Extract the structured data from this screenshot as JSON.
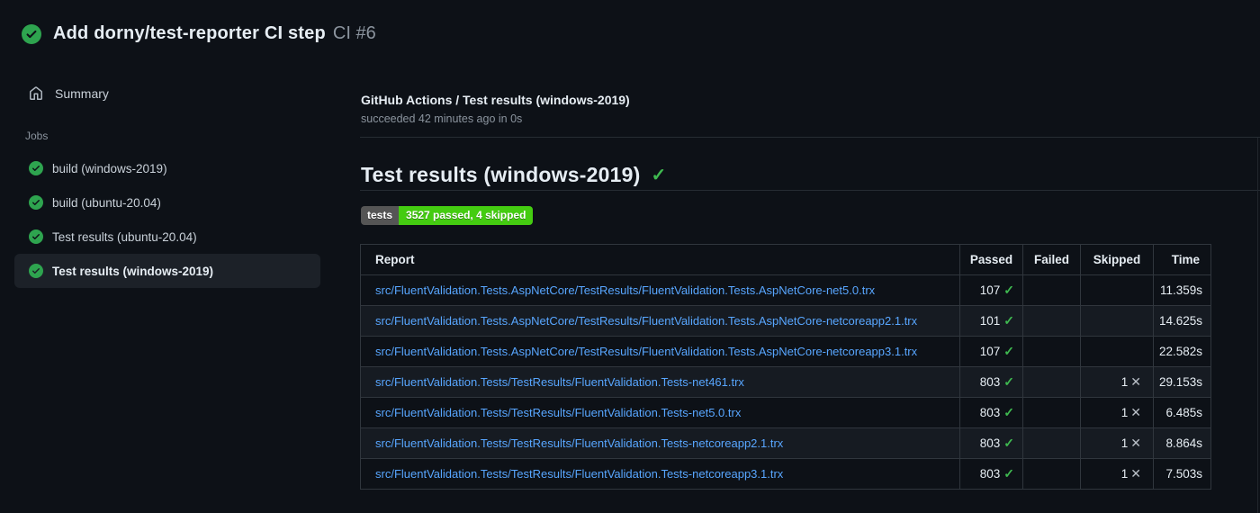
{
  "header": {
    "title": "Add dorny/test-reporter CI step",
    "run_number": "CI #6",
    "status_icon": "check-circle-icon"
  },
  "sidebar": {
    "summary_label": "Summary",
    "jobs_label": "Jobs",
    "jobs": [
      {
        "label": "build (windows-2019)",
        "selected": false
      },
      {
        "label": "build (ubuntu-20.04)",
        "selected": false
      },
      {
        "label": "Test results (ubuntu-20.04)",
        "selected": false
      },
      {
        "label": "Test results (windows-2019)",
        "selected": true
      }
    ]
  },
  "main": {
    "check_title": "GitHub Actions / Test results (windows-2019)",
    "check_status": "succeeded 42 minutes ago in 0s",
    "section_title": "Test results (windows-2019)",
    "badge": {
      "label": "tests",
      "value": "3527 passed, 4 skipped",
      "label_bg": "#555555",
      "value_bg": "#44cc11"
    },
    "table": {
      "columns": [
        "Report",
        "Passed",
        "Failed",
        "Skipped",
        "Time"
      ],
      "rows": [
        {
          "report": "src/FluentValidation.Tests.AspNetCore/TestResults/FluentValidation.Tests.AspNetCore-net5.0.trx",
          "passed": "107",
          "failed": "",
          "skipped": "",
          "time": "11.359s"
        },
        {
          "report": "src/FluentValidation.Tests.AspNetCore/TestResults/FluentValidation.Tests.AspNetCore-netcoreapp2.1.trx",
          "passed": "101",
          "failed": "",
          "skipped": "",
          "time": "14.625s"
        },
        {
          "report": "src/FluentValidation.Tests.AspNetCore/TestResults/FluentValidation.Tests.AspNetCore-netcoreapp3.1.trx",
          "passed": "107",
          "failed": "",
          "skipped": "",
          "time": "22.582s"
        },
        {
          "report": "src/FluentValidation.Tests/TestResults/FluentValidation.Tests-net461.trx",
          "passed": "803",
          "failed": "",
          "skipped": "1",
          "time": "29.153s"
        },
        {
          "report": "src/FluentValidation.Tests/TestResults/FluentValidation.Tests-net5.0.trx",
          "passed": "803",
          "failed": "",
          "skipped": "1",
          "time": "6.485s"
        },
        {
          "report": "src/FluentValidation.Tests/TestResults/FluentValidation.Tests-netcoreapp2.1.trx",
          "passed": "803",
          "failed": "",
          "skipped": "1",
          "time": "8.864s"
        },
        {
          "report": "src/FluentValidation.Tests/TestResults/FluentValidation.Tests-netcoreapp3.1.trx",
          "passed": "803",
          "failed": "",
          "skipped": "1",
          "time": "7.503s"
        }
      ]
    }
  },
  "glyphs": {
    "check": "✓",
    "cross": "✕"
  },
  "colors": {
    "page_bg": "#0d1117",
    "stripe_bg": "#161b22",
    "success_green": "#2ea44f",
    "check_green": "#3fb950",
    "link_blue": "#58a6ff",
    "muted_text": "#8b949e",
    "border": "#30363d"
  }
}
